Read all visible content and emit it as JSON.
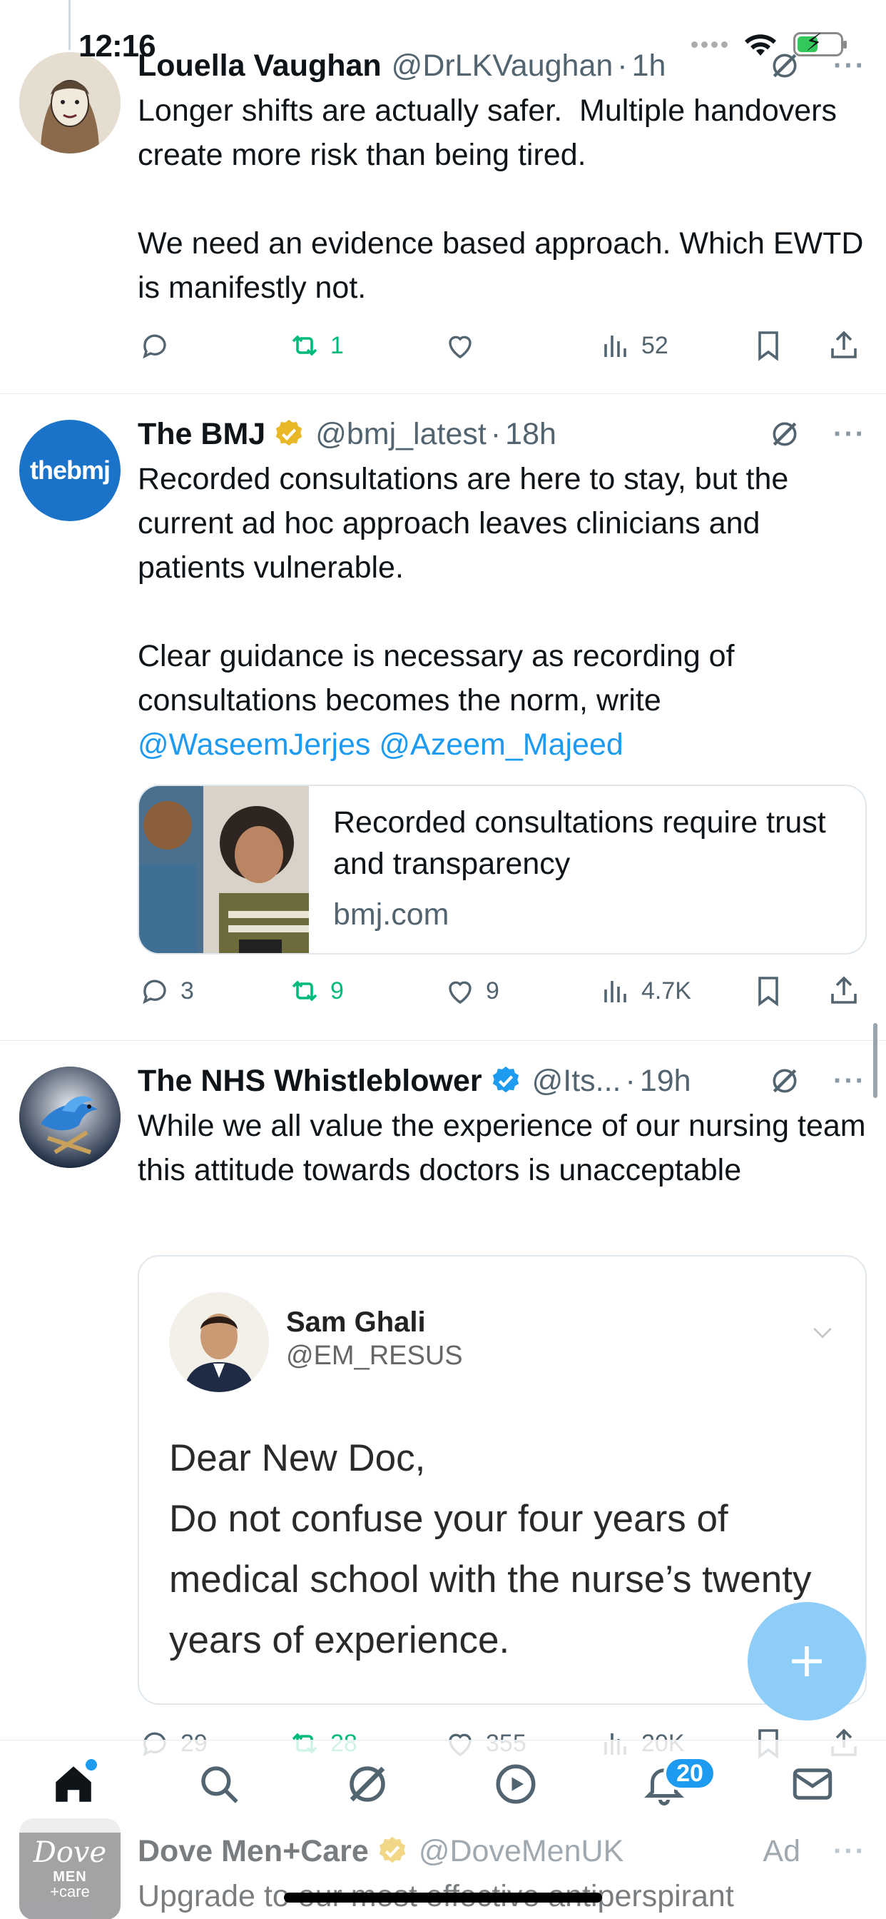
{
  "status_bar": {
    "time": "12:16"
  },
  "tweets": [
    {
      "name": "Louella Vaughan",
      "handle": "@DrLKVaughan",
      "time": "1h",
      "text": "Longer shifts are actually safer.  Multiple handovers create more risk than being tired.\n\nWe need an evidence based approach. Which EWTD is manifestly not.",
      "replies": "",
      "retweets": "1",
      "likes": "",
      "views": "52"
    },
    {
      "name": "The BMJ",
      "handle": "@bmj_latest",
      "time": "18h",
      "verified": "gold",
      "avatar_text": "thebmj",
      "text": "Recorded consultations are here to stay, but the current ad hoc approach leaves clinicians and patients vulnerable.\n\nClear guidance is necessary as recording of consultations becomes the norm, write ",
      "mention_1": "@WaseemJerjes",
      "mention_2": "@Azeem_Majeed",
      "link_card": {
        "title": "Recorded consultations require trust and transparency",
        "domain": "bmj.com"
      },
      "replies": "3",
      "retweets": "9",
      "likes": "9",
      "views": "4.7K"
    },
    {
      "name": "The NHS Whistleblower",
      "handle": "@Its...",
      "time": "19h",
      "verified": "blue",
      "text": "While we all value the experience of our nursing team this attitude towards doctors is unacceptable",
      "quote": {
        "name": "Sam Ghali",
        "handle": "@EM_RESUS",
        "text": "Dear New Doc,\nDo not confuse your four years of medical school with the nurse’s twenty years of experience."
      },
      "replies": "29",
      "retweets": "28",
      "likes": "355",
      "views": "20K"
    }
  ],
  "ad": {
    "name": "Dove Men+Care",
    "handle": "@DoveMenUK",
    "label": "Ad",
    "logo": {
      "line1": "Dove",
      "line2": "MEN",
      "line3": "+care"
    },
    "text": "Upgrade to our most effective antiperspirant"
  },
  "tab_bar": {
    "items": [
      "home-icon",
      "search-icon",
      "grok-icon",
      "video-icon",
      "notifications-icon",
      "messages-icon"
    ],
    "notifications_badge": "20",
    "accent_color": "#1d9bf0"
  },
  "icons": [
    "reply-icon",
    "retweet-icon",
    "like-icon",
    "views-icon",
    "bookmark-icon",
    "share-icon",
    "compose-icon"
  ]
}
